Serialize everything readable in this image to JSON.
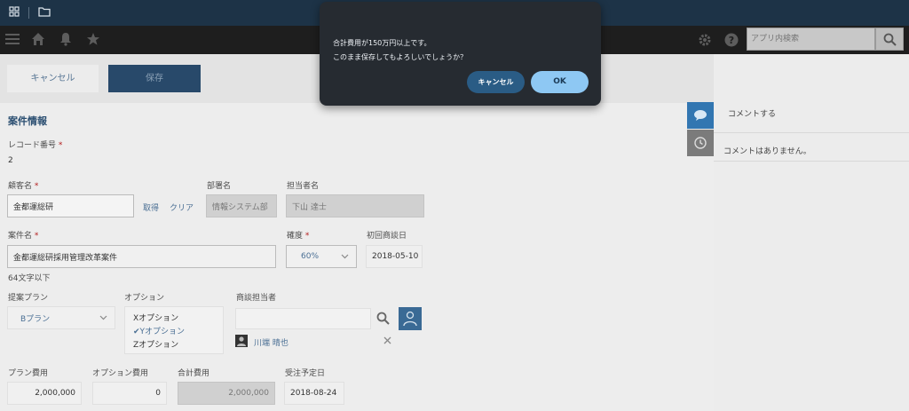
{
  "app": {
    "search_placeholder": "アプリ内検索"
  },
  "toolbar": {
    "cancel_label": "キャンセル",
    "save_label": "保存"
  },
  "form": {
    "section_title": "案件情報",
    "record_number": {
      "label": "レコード番号",
      "value": "2"
    },
    "customer": {
      "label": "顧客名",
      "value": "金都運総研",
      "lookup_link": "取得",
      "clear_link": "クリア"
    },
    "department": {
      "label": "部署名",
      "value": "情報システム部"
    },
    "person_in_charge": {
      "label": "担当者名",
      "value": "下山 達士"
    },
    "project_name": {
      "label": "案件名",
      "value": "金都運総研採用管理改革案件",
      "hint": "64文字以下"
    },
    "certainty": {
      "label": "確度",
      "value": "60%"
    },
    "first_meeting": {
      "label": "初回商談日",
      "value": "2018-05-10"
    },
    "plan": {
      "label": "提案プラン",
      "value": "Bプラン"
    },
    "options": {
      "label": "オプション",
      "items": [
        "Xオプション",
        "Yオプション",
        "Zオプション"
      ],
      "checked_mark": "✔"
    },
    "sales_rep": {
      "label": "商談担当者",
      "user_name": "川端 晴也"
    },
    "plan_cost": {
      "label": "プラン費用",
      "value": "2,000,000"
    },
    "option_cost": {
      "label": "オプション費用",
      "value": "0"
    },
    "total_cost": {
      "label": "合計費用",
      "value": "2,000,000"
    },
    "order_date": {
      "label": "受注予定日",
      "value": "2018-08-24"
    }
  },
  "side_panel": {
    "comment_prompt": "コメントする",
    "no_comments": "コメントはありません。"
  },
  "dialog": {
    "line1": "合計費用が150万円以上です。",
    "line2": "このまま保存してもよろしいでしょうか？",
    "cancel_label": "キャンセル",
    "ok_label": "OK"
  },
  "icons": [
    "apps-grid-icon",
    "folder-icon",
    "menu-icon",
    "home-icon",
    "bell-icon",
    "star-icon",
    "gear-icon",
    "help-icon",
    "search-icon",
    "user-picker-icon",
    "comment-icon",
    "history-icon",
    "close-icon"
  ],
  "colors": {
    "topbar": "#1d3347",
    "save_button": "#28496a",
    "dialog_bg": "#262b31",
    "ok_button": "#8ec8f3",
    "dialog_cancel": "#2a5c85",
    "required": "#b31d1d"
  }
}
